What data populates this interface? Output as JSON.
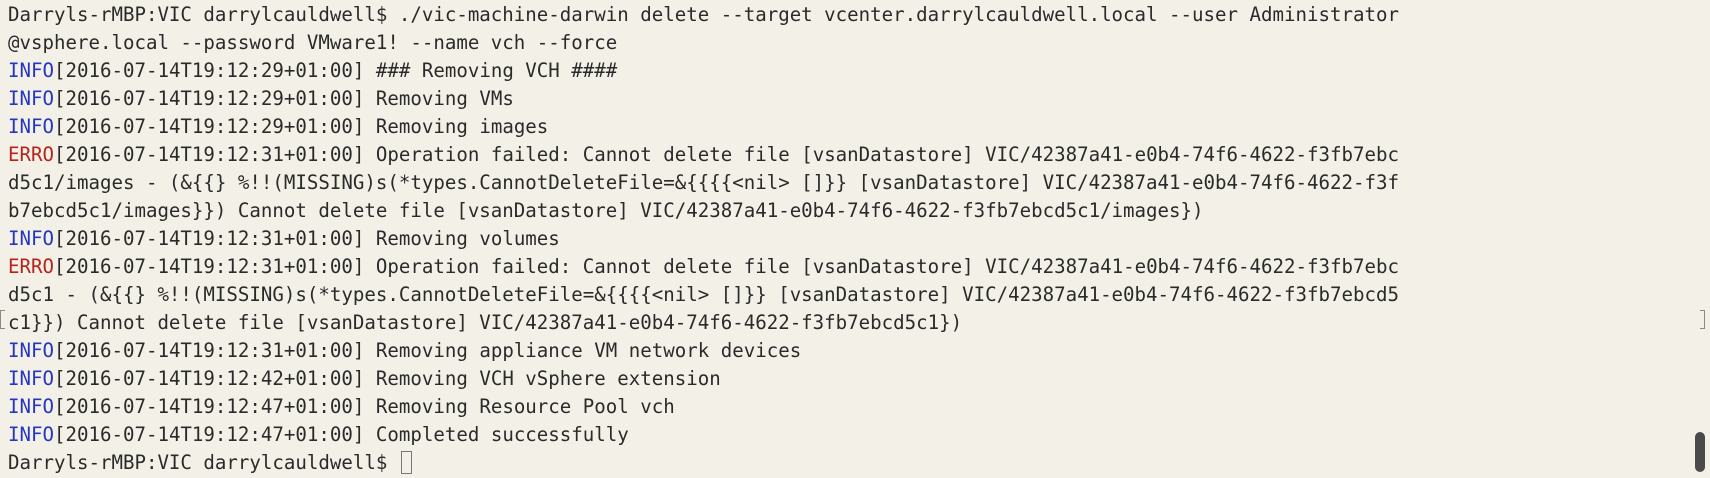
{
  "terminal": {
    "colors": {
      "background": "#f3f1e7",
      "text": "#2a2a2a",
      "info": "#2436c2",
      "error": "#b8231b"
    },
    "command_line_1": "Darryls-rMBP:VIC darrylcauldwell$ ./vic-machine-darwin delete --target vcenter.darrylcauldwell.local --user Administrator",
    "command_line_2": "@vsphere.local --password VMware1! --name vch --force",
    "logs": [
      {
        "level": "INFO",
        "ts": "[2016-07-14T19:12:29+01:00]",
        "msg": " ### Removing VCH ####"
      },
      {
        "level": "INFO",
        "ts": "[2016-07-14T19:12:29+01:00]",
        "msg": " Removing VMs"
      },
      {
        "level": "INFO",
        "ts": "[2016-07-14T19:12:29+01:00]",
        "msg": " Removing images"
      },
      {
        "level": "ERRO",
        "ts": "[2016-07-14T19:12:31+01:00]",
        "msg": " Operation failed: Cannot delete file [vsanDatastore] VIC/42387a41-e0b4-74f6-4622-f3fb7ebc"
      },
      {
        "cont": "d5c1/images - (&{{} %!!(MISSING)s(*types.CannotDeleteFile=&{{{{<nil> []}} [vsanDatastore] VIC/42387a41-e0b4-74f6-4622-f3f"
      },
      {
        "cont": "b7ebcd5c1/images}}) Cannot delete file [vsanDatastore] VIC/42387a41-e0b4-74f6-4622-f3fb7ebcd5c1/images})"
      },
      {
        "level": "INFO",
        "ts": "[2016-07-14T19:12:31+01:00]",
        "msg": " Removing volumes"
      },
      {
        "level": "ERRO",
        "ts": "[2016-07-14T19:12:31+01:00]",
        "msg": " Operation failed: Cannot delete file [vsanDatastore] VIC/42387a41-e0b4-74f6-4622-f3fb7ebc"
      },
      {
        "cont": "d5c1 - (&{{} %!!(MISSING)s(*types.CannotDeleteFile=&{{{{<nil> []}} [vsanDatastore] VIC/42387a41-e0b4-74f6-4622-f3fb7ebcd5"
      },
      {
        "cont": "c1}}) Cannot delete file [vsanDatastore] VIC/42387a41-e0b4-74f6-4622-f3fb7ebcd5c1})"
      },
      {
        "level": "INFO",
        "ts": "[2016-07-14T19:12:31+01:00]",
        "msg": " Removing appliance VM network devices"
      },
      {
        "level": "INFO",
        "ts": "[2016-07-14T19:12:42+01:00]",
        "msg": " Removing VCH vSphere extension"
      },
      {
        "level": "INFO",
        "ts": "[2016-07-14T19:12:47+01:00]",
        "msg": " Removing Resource Pool vch"
      },
      {
        "level": "INFO",
        "ts": "[2016-07-14T19:12:47+01:00]",
        "msg": " Completed successfully"
      }
    ],
    "prompt": "Darryls-rMBP:VIC darrylcauldwell$ "
  }
}
